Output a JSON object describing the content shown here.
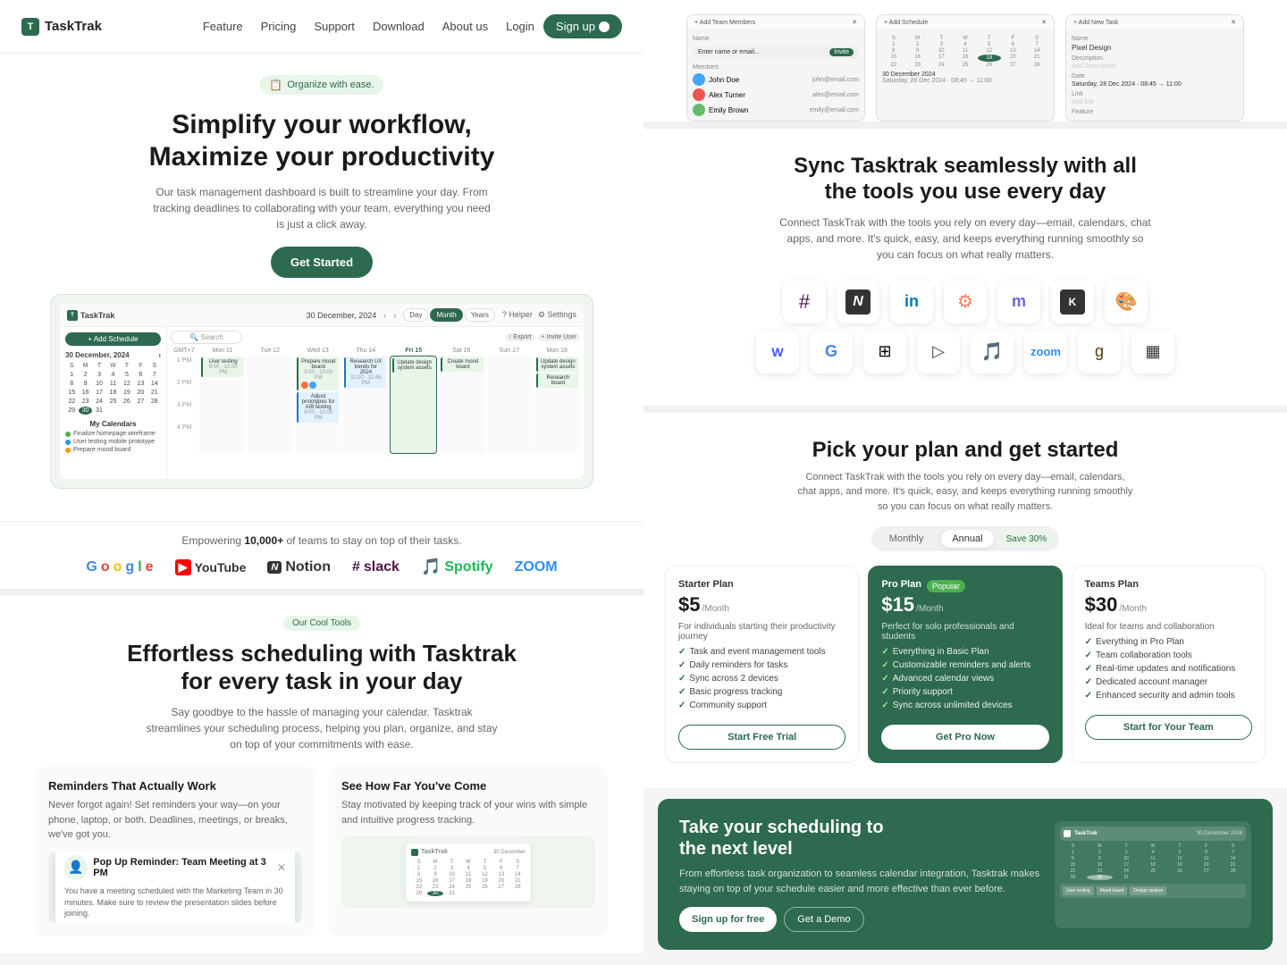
{
  "nav": {
    "logo": "TaskTrak",
    "links": [
      "Feature",
      "Pricing",
      "Support",
      "Download",
      "About us"
    ],
    "login": "Login",
    "signup": "Sign up"
  },
  "hero": {
    "badge": "Organize with ease.",
    "title_line1": "Simplify your workflow,",
    "title_line2": "Maximize your productivity",
    "subtitle": "Our task management dashboard is built to streamline your day. From tracking deadlines to collaborating with your team, everything you need is just a click away.",
    "cta": "Get Started"
  },
  "trusted": {
    "text_before": "Empowering ",
    "highlight": "10,000+",
    "text_after": " of teams to stay on top of their tasks.",
    "brands": [
      "Google",
      "YouTube",
      "Notion",
      "slack",
      "Spotify",
      "ZOOM"
    ]
  },
  "tools": {
    "badge": "Our Cool Tools",
    "title_line1": "Effortless scheduling with Tasktrak",
    "title_line2": "for every task in your day",
    "subtitle": "Say goodbye to the hassle of managing your calendar. Tasktrak streamlines your scheduling process, helping you plan, organize, and stay on top of your commitments with ease."
  },
  "features": [
    {
      "title": "Reminders That Actually Work",
      "desc": "Never forgot again! Set reminders your way—on your phone, laptop, or both. Deadlines, meetings, or breaks, we've got you.",
      "popup_title": "Pop Up Reminder:",
      "popup_subtitle": "Team Meeting at 3 PM",
      "popup_body": "You have a meeting scheduled with the Marketing Team in 30 minutes. Make sure to review the presentation slides before joining."
    },
    {
      "title": "See How Far You've Come",
      "desc": "Stay motivated by keeping track of your wins with simple and intuitive progress tracking."
    }
  ],
  "sync": {
    "title_line1": "Sync Tasktrak seamlessly with all",
    "title_line2": "the tools you use every day",
    "subtitle": "Connect TaskTrak with the tools you rely on every day—email, calendars, chat apps, and more. It's quick, easy, and keeps everything running smoothly so you can focus on what really matters.",
    "integrations_row1": [
      "slack",
      "notion",
      "linkedin",
      "hubspot",
      "monday",
      "klaviyo",
      "figma"
    ],
    "integrations_row2": [
      "webflow",
      "google",
      "microsoft",
      "prompt",
      "spotify",
      "zoom",
      "goodreads",
      "buffer"
    ]
  },
  "pricing": {
    "title": "Pick your plan and get started",
    "subtitle": "Connect TaskTrak with the tools you rely on every day—email, calendars, chat apps, and more. It's quick, easy, and keeps everything running smoothly so you can focus on what really matters.",
    "toggle": {
      "monthly": "Monthly",
      "annual": "Annual",
      "save": "Save 30%",
      "active": "Annual"
    },
    "plans": [
      {
        "name": "Starter Plan",
        "price": "$5",
        "period": "/Month",
        "desc": "For individuals starting their productivity journey",
        "features": [
          "Task and event management tools",
          "Daily reminders for tasks",
          "Sync across 2 devices",
          "Basic progress tracking",
          "Community support"
        ],
        "cta": "Start Free Trial",
        "featured": false
      },
      {
        "name": "Pro Plan",
        "badge": "Popular",
        "price": "$15",
        "period": "/Month",
        "desc": "Perfect for solo professionals and students",
        "features": [
          "Everything in Basic Plan",
          "Customizable reminders and alerts",
          "Advanced calendar views",
          "Priority support",
          "Sync across unlimited devices"
        ],
        "cta": "Get Pro Now",
        "featured": true
      },
      {
        "name": "Teams Plan",
        "price": "$30",
        "period": "/Month",
        "desc": "Ideal for teams and collaboration",
        "features": [
          "Everything in Pro Plan",
          "Team collaboration tools",
          "Real-time updates and notifications",
          "Dedicated account manager",
          "Enhanced security and admin tools"
        ],
        "cta": "Start for Your Team",
        "featured": false
      }
    ]
  },
  "cta_banner": {
    "title_line1": "Take your scheduling to",
    "title_line2": "the next level",
    "desc": "From effortless task organization to seamless calendar integration, Tasktrak makes staying on top of your schedule easier and more effective than ever before.",
    "btn1": "Sign up for free",
    "btn2": "Get a Demo"
  },
  "dashboard": {
    "date": "30 December, 2024",
    "add_schedule": "Add Schedule +",
    "search": "Search",
    "views": [
      "Day",
      "Month",
      "Years"
    ],
    "active_view": "Month",
    "right_icons": [
      "Helper",
      "Settings"
    ]
  }
}
